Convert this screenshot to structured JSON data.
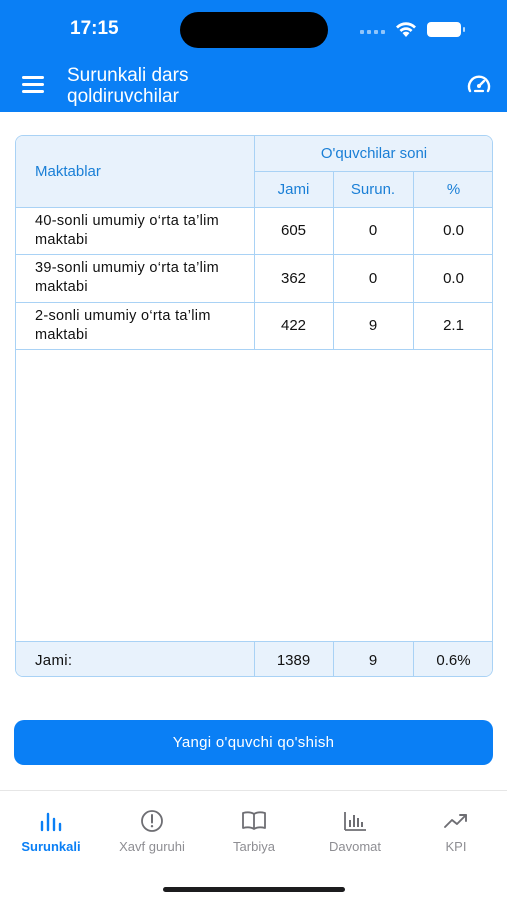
{
  "status": {
    "time": "17:15"
  },
  "header": {
    "title": "Surunkali dars qoldiruvchilar",
    "menu_icon": "menu-icon",
    "action_icon": "gauge-icon"
  },
  "table": {
    "col_school": "Maktablar",
    "col_group": "O'quvchilar soni",
    "col_total": "Jami",
    "col_chronic": "Surun.",
    "col_percent": "%",
    "rows": [
      {
        "name": "40-sonli umumiy o‘rta ta’lim maktabi",
        "total": "605",
        "chronic": "0",
        "percent": "0.0"
      },
      {
        "name": "39-sonli umumiy o‘rta ta’lim maktabi",
        "total": "362",
        "chronic": "0",
        "percent": "0.0"
      },
      {
        "name": "2-sonli umumiy o‘rta ta’lim maktabi",
        "total": "422",
        "chronic": "9",
        "percent": "2.1"
      }
    ],
    "footer": {
      "label": "Jami:",
      "total": "1389",
      "chronic": "9",
      "percent": "0.6%"
    }
  },
  "actions": {
    "add_student": "Yangi o'quvchi qo'shish"
  },
  "tabs": [
    {
      "label": "Surunkali",
      "icon": "bar-chart-icon",
      "active": true
    },
    {
      "label": "Xavf guruhi",
      "icon": "alert-circle-icon",
      "active": false
    },
    {
      "label": "Tarbiya",
      "icon": "book-icon",
      "active": false
    },
    {
      "label": "Davomat",
      "icon": "column-chart-icon",
      "active": false
    },
    {
      "label": "KPI",
      "icon": "trend-up-icon",
      "active": false
    }
  ],
  "colors": {
    "primary": "#0a7ff5",
    "header_cell": "#e8f2fc",
    "border": "#a9d2f5",
    "inactive_tab": "#8e8e93"
  }
}
